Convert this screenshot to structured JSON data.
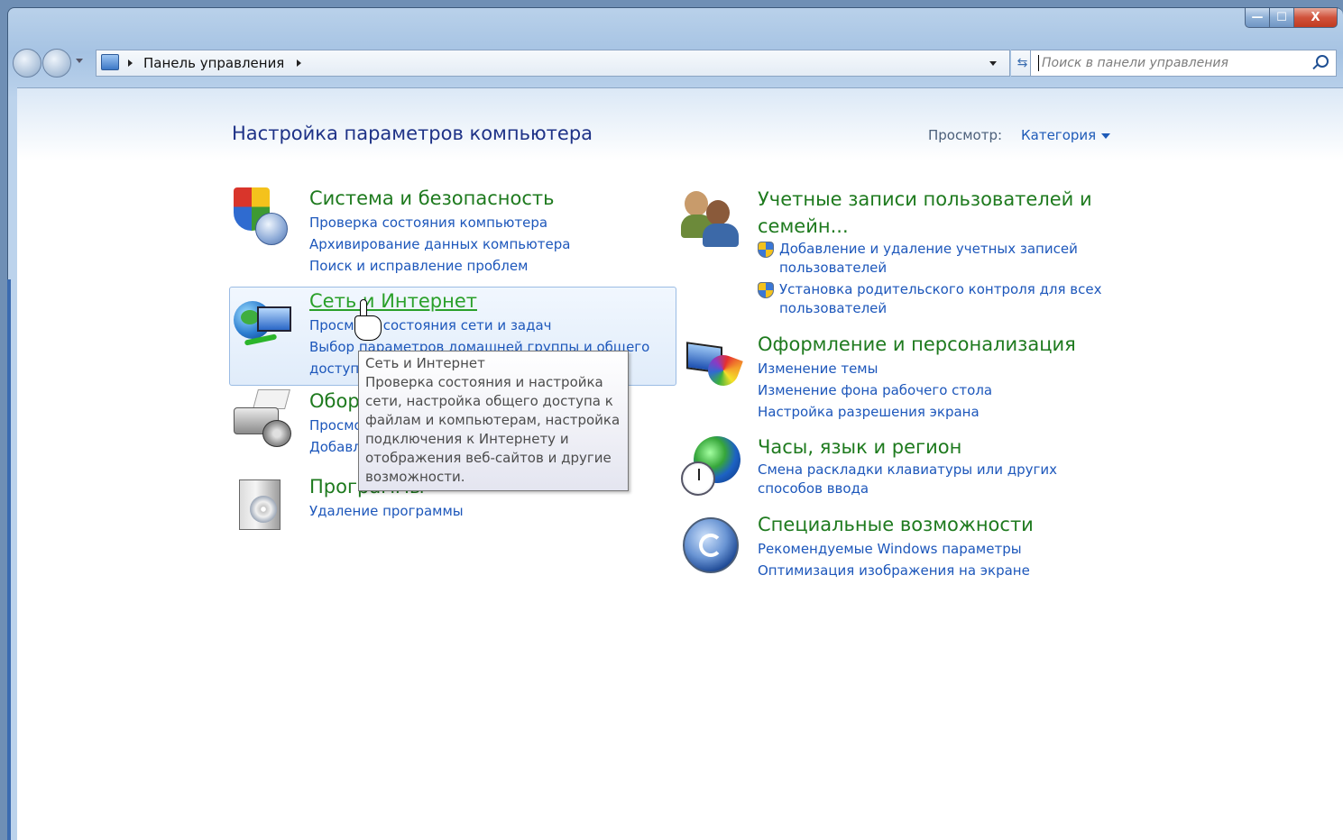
{
  "window": {
    "caption_buttons": {
      "minimize": "—",
      "maximize": "☐",
      "close": "X"
    }
  },
  "navbar": {
    "breadcrumb": "Панель управления",
    "search_placeholder": "Поиск в панели управления",
    "refresh_glyph": "⇆"
  },
  "header": {
    "title": "Настройка параметров компьютера",
    "view_label": "Просмотр:",
    "view_value": "Категория"
  },
  "categories": {
    "system": {
      "title": "Система и безопасность",
      "links": [
        "Проверка состояния компьютера",
        "Архивирование данных компьютера",
        "Поиск и исправление проблем"
      ]
    },
    "network": {
      "title": "Сеть и Интернет",
      "links": [
        "Просмотр состояния сети и задач",
        "Выбор параметров домашней группы и общего доступа"
      ]
    },
    "hardware": {
      "title": "Оборудование и звук",
      "links": [
        "Просмотр устройств и принтеров",
        "Добавление устройства"
      ]
    },
    "programs": {
      "title": "Программы",
      "links": [
        "Удаление программы"
      ]
    },
    "users": {
      "title_line1": "Учетные записи пользователей и",
      "title_line2": "семейн...",
      "links": [
        {
          "line1": "Добавление и удаление учетных записей",
          "line2": "пользователей"
        },
        {
          "line1": "Установка родительского контроля для всех",
          "line2": "пользователей"
        }
      ]
    },
    "appearance": {
      "title": "Оформление и персонализация",
      "links": [
        "Изменение темы",
        "Изменение фона рабочего стола",
        "Настройка разрешения экрана"
      ]
    },
    "clock": {
      "title": "Часы, язык и регион",
      "links": [
        "Смена раскладки клавиатуры или других",
        "способов ввода"
      ]
    },
    "access": {
      "title": "Специальные возможности",
      "links": [
        "Рекомендуемые Windows параметры",
        "Оптимизация изображения на экране"
      ]
    }
  },
  "tooltip": {
    "title": "Сеть и Интернет",
    "lines": [
      "Проверка состояния и настройка",
      "сети, настройка общего доступа к",
      "файлам и компьютерам, настройка",
      "подключения к Интернету и",
      "отображения веб-сайтов и другие",
      "возможности."
    ]
  }
}
